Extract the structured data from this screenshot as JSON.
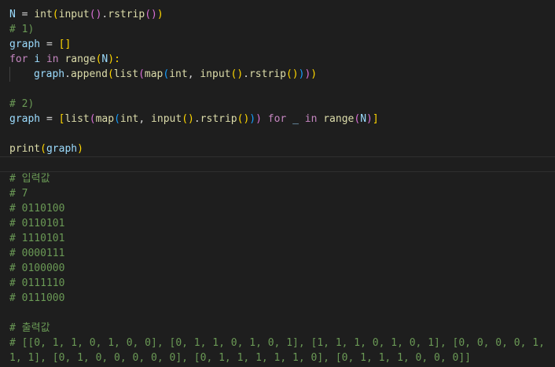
{
  "editor": {
    "lines": [
      [
        "N",
        " = ",
        "int",
        "(",
        "input",
        "(",
        ")",
        ".",
        "rstrip",
        "(",
        ")",
        ")"
      ],
      [
        "# 1)"
      ],
      [
        "graph",
        " = ",
        "[",
        "]"
      ],
      [
        "for",
        " ",
        "i",
        " ",
        "in",
        " ",
        "range",
        "(",
        "N",
        "):"
      ],
      [
        "graph",
        ".",
        "append",
        "(",
        "list",
        "(",
        "map",
        "(",
        "int",
        ", ",
        "input",
        "(",
        ")",
        ".",
        "rstrip",
        "(",
        ")",
        ")",
        ")",
        ")"
      ],
      [],
      [
        "# 2)"
      ],
      [
        "graph",
        " = ",
        "[",
        "list",
        "(",
        "map",
        "(",
        "int",
        ", ",
        "input",
        "(",
        ")",
        ".",
        "rstrip",
        "(",
        ")",
        ")",
        ")",
        " ",
        "for",
        " ",
        "_",
        " ",
        "in",
        " ",
        "range",
        "(",
        "N",
        ")",
        "]"
      ],
      [],
      [
        "print",
        "(",
        "graph",
        ")"
      ],
      [],
      [
        "# 입력값"
      ],
      [
        "# 7"
      ],
      [
        "# 0110100"
      ],
      [
        "# 0110101"
      ],
      [
        "# 1110101"
      ],
      [
        "# 0000111"
      ],
      [
        "# 0100000"
      ],
      [
        "# 0111110"
      ],
      [
        "# 0111000"
      ],
      [],
      [
        "# 출력값"
      ],
      [
        "# [[0, 1, 1, 0, 1, 0, 0], [0, 1, 1, 0, 1, 0, 1], [1, 1, 1, 0, 1, 0, 1], [0, 0, 0, 0, 1, 1, 1], [0, 1, 0, 0, 0, 0, 0], [0, 1, 1, 1, 1, 1, 0], [0, 1, 1, 1, 0, 0, 0]]"
      ]
    ]
  },
  "colors": {
    "background": "#1e1e1e",
    "variable": "#9cdcfe",
    "function": "#dcdcaa",
    "keyword": "#c586c0",
    "comment": "#6a9955",
    "bracket_level1": "#ffd700",
    "bracket_level2": "#da70d6",
    "bracket_level3": "#179fff"
  }
}
